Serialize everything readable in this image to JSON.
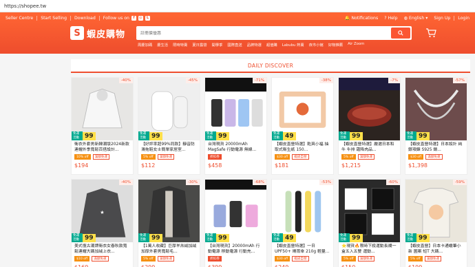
{
  "browser": {
    "url": "https://shopee.tw"
  },
  "topnav": {
    "seller_centre": "Seller Centre",
    "start_selling": "Start Selling",
    "download": "Download",
    "follow_us": "Follow us on",
    "notifications": "Notifications",
    "help": "Help",
    "language": "English",
    "signup": "Sign Up",
    "login": "Login"
  },
  "logo": {
    "text": "蝦皮購物",
    "symbol": "S"
  },
  "search": {
    "placeholder": "註冊搶優惠"
  },
  "suggestions": [
    "周慶加碼",
    "慶生活",
    "限時特賣",
    "夏日露營",
    "開學季",
    "國際直送",
    "品牌特選",
    "超值購",
    "Labubu 熱賣",
    "夜市小館",
    "好物推薦",
    "Air Zoom"
  ],
  "discover_title": "DAILY DISCOVER",
  "colors": {
    "brand": "#ee4d2d",
    "badge_green": "#00a98f",
    "badge_yellow": "#ffe04a"
  },
  "products": [
    {
      "title": "衛衣外套男新韓潮版2024新款連帽外季寬鬆百搭設計...",
      "price": "$194",
      "discount": "-40%",
      "badge_num": "99",
      "tags": [
        "10% off",
        "滿額免運"
      ],
      "img": "hoodie-white"
    },
    {
      "title": "【好評率超99%同款】靜音防滑拖鞋女士簡單家居室...",
      "price": "$112",
      "discount": "-45%",
      "badge_num": "99",
      "tags": [
        "5% off",
        "滿額免運"
      ],
      "img": "slippers"
    },
    {
      "title": "台灣現貨 20000mAh MagSafe 行動電源 無線...",
      "price": "$458",
      "discount": "-71%",
      "badge_num": "99",
      "tags": [
        "折扣券"
      ],
      "img": "powerbank"
    },
    {
      "title": "【蝦皮直營特選】乾爽小福 抽取式衛生紙 150...",
      "price": "$181",
      "discount": "-38%",
      "badge_num": "49",
      "tags": [
        "$30 off",
        "蝦皮自營"
      ],
      "img": "tissue"
    },
    {
      "title": "【蝦皮直營特選】嚴選日本和牛 牛排 霜降肉品...",
      "price": "$1,215",
      "discount": "-7%",
      "badge_num": "99",
      "tags": [
        "5% off",
        "滿額免運"
      ],
      "img": "steak"
    },
    {
      "title": "【蝦皮直營特選】日本設計 純銀項鍊 S925 鎖...",
      "price": "$1,398",
      "discount": "-57%",
      "badge_num": "99",
      "tags": [
        "$30 off",
        "滿額免運"
      ],
      "img": "jewelry"
    },
    {
      "title": "美式復古潮牌衛衣女春秋款寬鬆連帽大碼加絨上衣...",
      "price": "$169",
      "discount": "-40%",
      "badge_num": "99",
      "tags": [
        "$10 off",
        "滿額免運"
      ],
      "img": "hoodie-grey"
    },
    {
      "title": "【1萬人收藏】巨厚羊羔絨加絨加厚外套男寬鬆毛...",
      "price": "$299",
      "discount": "-30%",
      "badge_num": "99",
      "tags": [
        "5% off",
        "滿額免運"
      ],
      "img": "jacket"
    },
    {
      "title": "【台灣現貨】20000mAh 行動電源 移動電源 行動充...",
      "price": "$399",
      "discount": "-68%",
      "badge_num": "99",
      "tags": [
        "折扣券"
      ],
      "img": "charger"
    },
    {
      "title": "【蝦皮直營特選】一日 UPF50+ 晴雨傘 210g 輕量...",
      "price": "$249",
      "discount": "-53%",
      "badge_num": "49",
      "tags": [
        "$30 off",
        "蝦皮自營"
      ],
      "img": "umbrella"
    },
    {
      "title": "⭐現貨🔥限時下殺運動長襪一盒五入五雙 運動...",
      "price": "$150",
      "discount": "-60%",
      "badge_num": "99",
      "tags": [
        "5% off",
        "滿額免運"
      ],
      "img": "socks"
    },
    {
      "title": "【蝦皮直營】日本卡通蠟筆小新 圖案 短T 大碼...",
      "price": "$199",
      "discount": "-59%",
      "badge_num": "99",
      "tags": [
        "5% off",
        "滿額免運"
      ],
      "img": "tshirt"
    }
  ]
}
